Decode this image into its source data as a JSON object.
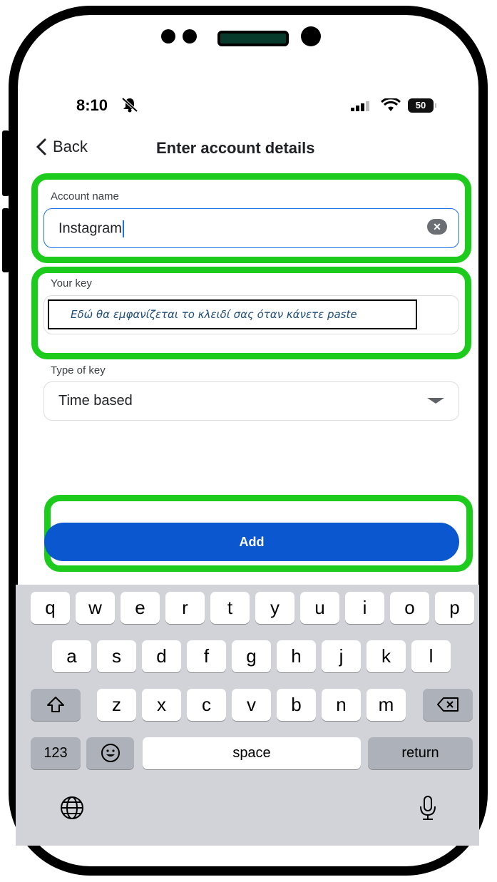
{
  "status_bar": {
    "time": "8:10",
    "battery": "50"
  },
  "nav": {
    "back_label": "Back",
    "title": "Enter account details"
  },
  "form": {
    "account_name_label": "Account name",
    "account_name_value": "Instagram",
    "key_label": "Your key",
    "key_annotation": "Εδώ θα εμφανίζεται το κλειδί σας όταν κάνετε paste",
    "type_label": "Type of key",
    "type_value": "Time based"
  },
  "add_button": "Add",
  "keyboard": {
    "row1": [
      "q",
      "w",
      "e",
      "r",
      "t",
      "y",
      "u",
      "i",
      "o",
      "p"
    ],
    "row2": [
      "a",
      "s",
      "d",
      "f",
      "g",
      "h",
      "j",
      "k",
      "l"
    ],
    "row3": [
      "z",
      "x",
      "c",
      "v",
      "b",
      "n",
      "m"
    ],
    "numbers_key": "123",
    "space_key": "space",
    "return_key": "return"
  },
  "colors": {
    "highlight": "#1ccb1c",
    "primary": "#0b57d0",
    "focus": "#1a73e8"
  },
  "icons": [
    "bell-slash-icon",
    "signal-icon",
    "wifi-icon",
    "battery-icon",
    "chevron-left-icon",
    "clear-icon",
    "dropdown-arrow-icon",
    "shift-icon",
    "backspace-icon",
    "emoji-icon",
    "globe-icon",
    "microphone-icon"
  ]
}
